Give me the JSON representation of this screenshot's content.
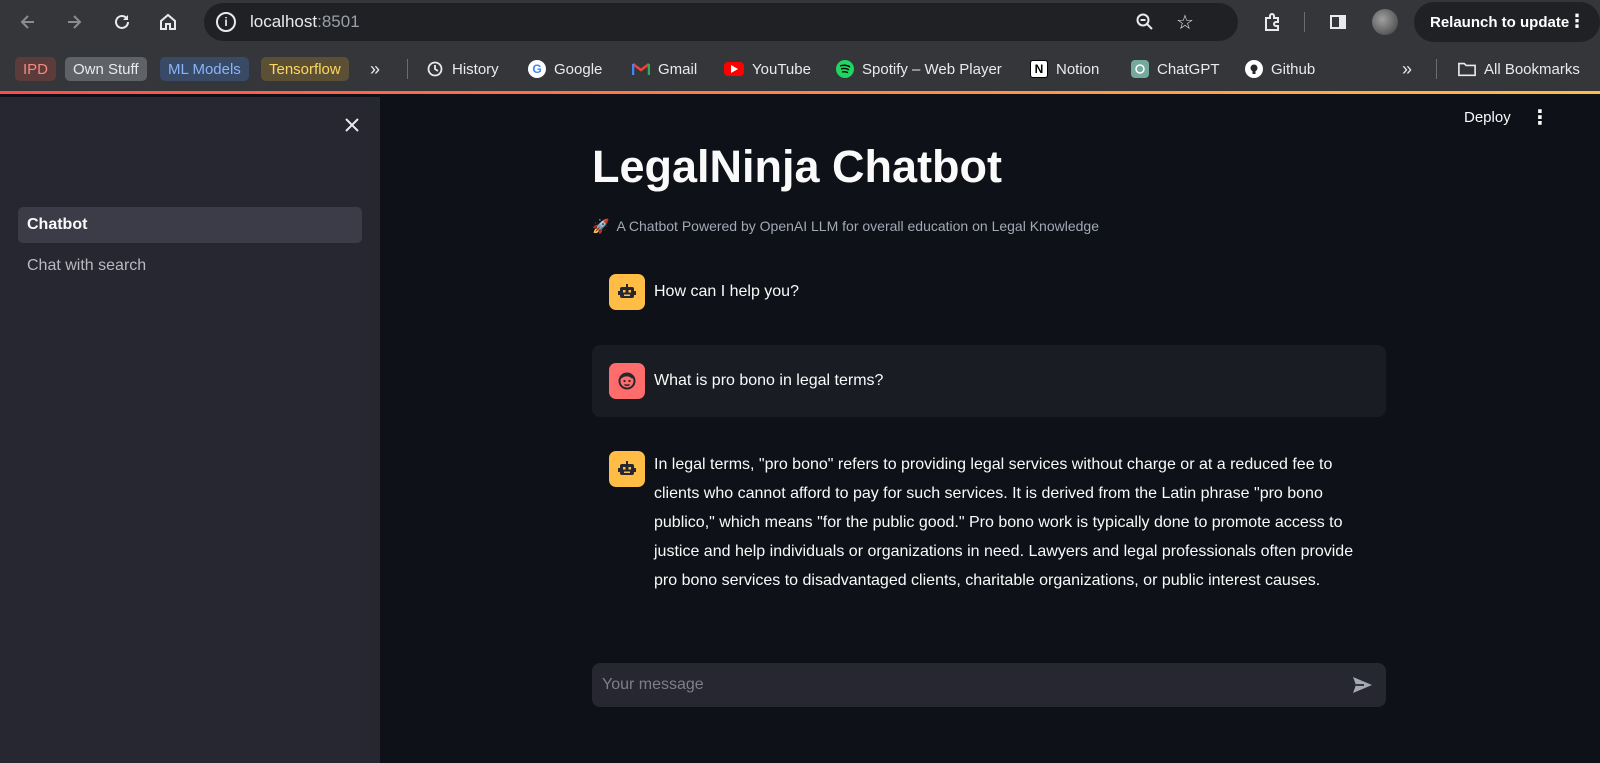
{
  "browser": {
    "url_host": "localhost",
    "url_port": ":8501",
    "relaunch_label": "Relaunch to update"
  },
  "bookmarks": {
    "chips": [
      {
        "label": "IPD",
        "bg": "#5c3b3b",
        "fg": "#f28b82"
      },
      {
        "label": "Own Stuff",
        "bg": "#5f6368",
        "fg": "#e8eaed"
      },
      {
        "label": "ML Models",
        "bg": "#394a66",
        "fg": "#8ab4f8"
      },
      {
        "label": "Tensorflow",
        "bg": "#5c5034",
        "fg": "#fdd663"
      }
    ],
    "items": [
      {
        "label": "History",
        "icon": "history-icon"
      },
      {
        "label": "Google",
        "icon": "google-icon"
      },
      {
        "label": "Gmail",
        "icon": "gmail-icon"
      },
      {
        "label": "YouTube",
        "icon": "youtube-icon"
      },
      {
        "label": "Spotify – Web Player",
        "icon": "spotify-icon"
      },
      {
        "label": "Notion",
        "icon": "notion-icon"
      },
      {
        "label": "ChatGPT",
        "icon": "chatgpt-icon"
      },
      {
        "label": "Github",
        "icon": "github-icon"
      }
    ],
    "all_bookmarks_label": "All Bookmarks"
  },
  "sidebar": {
    "items": [
      {
        "label": "Chatbot",
        "active": true
      },
      {
        "label": "Chat with search",
        "active": false
      }
    ]
  },
  "header": {
    "deploy_label": "Deploy"
  },
  "page": {
    "title": "LegalNinja Chatbot",
    "subtitle_emoji": "🚀",
    "subtitle": "A Chatbot Powered by OpenAI LLM for overall education on Legal Knowledge"
  },
  "messages": [
    {
      "role": "assistant",
      "text": "How can I help you?"
    },
    {
      "role": "user",
      "text": "What is pro bono in legal terms?"
    },
    {
      "role": "assistant",
      "text": "In legal terms, \"pro bono\" refers to providing legal services without charge or at a reduced fee to clients who cannot afford to pay for such services. It is derived from the Latin phrase \"pro bono publico,\" which means \"for the public good.\" Pro bono work is typically done to promote access to justice and help individuals or organizations in need. Lawyers and legal professionals often provide pro bono services to disadvantaged clients, charitable organizations, or public interest causes."
    }
  ],
  "chat_input": {
    "placeholder": "Your message",
    "value": ""
  },
  "colors": {
    "accent_bot": "#ffbd45",
    "accent_user": "#ff6c6c",
    "app_bg": "#0e1117",
    "sidebar_bg": "#262730"
  }
}
